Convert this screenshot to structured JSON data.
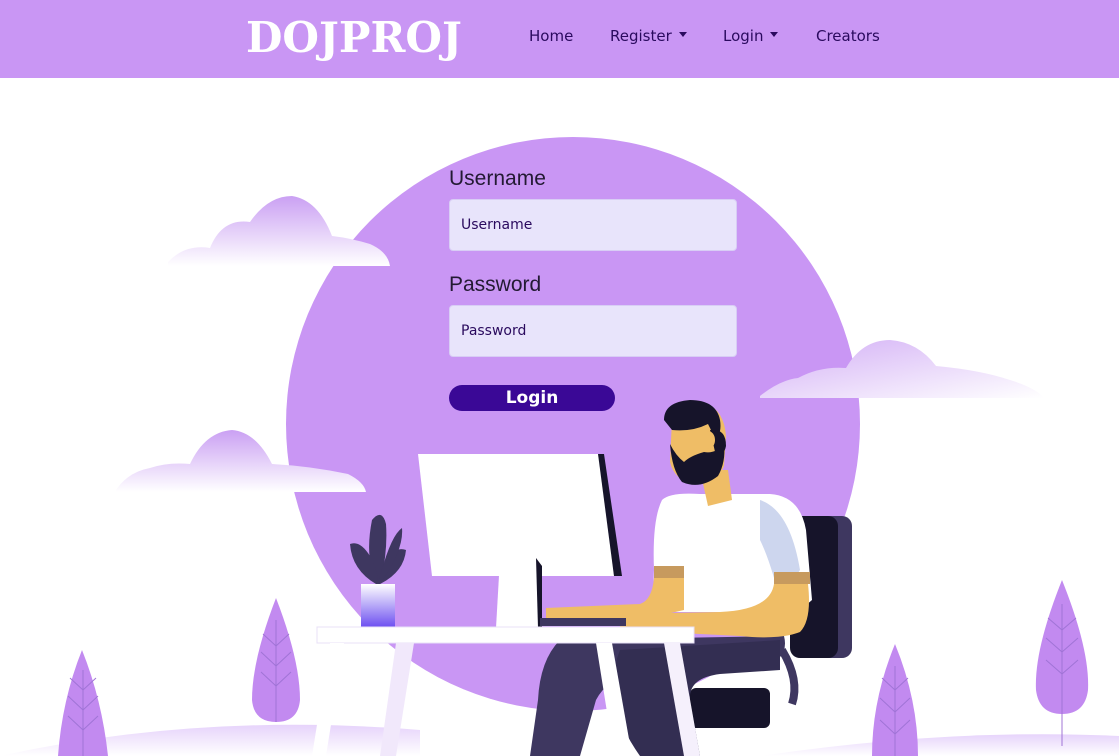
{
  "navbar": {
    "brand": "DOJPROJ",
    "links": [
      {
        "label": "Home"
      },
      {
        "label": "Register"
      },
      {
        "label": "Login"
      },
      {
        "label": "Creators"
      }
    ]
  },
  "form": {
    "username": {
      "label": "Username",
      "placeholder": "Username",
      "value": ""
    },
    "password": {
      "label": "Password",
      "placeholder": "Password",
      "value": ""
    },
    "submit_label": "Login"
  },
  "colors": {
    "navbar_bg": "#c996f4",
    "circle": "#c996f4",
    "input_bg": "#e8e4fb",
    "button_bg": "#3a0896",
    "text_dark": "#2a0a5e"
  },
  "icons": {
    "register_dropdown": "caret-down-icon",
    "login_dropdown": "caret-down-icon"
  },
  "illustration": {
    "subject": "person-at-computer-illustration"
  }
}
